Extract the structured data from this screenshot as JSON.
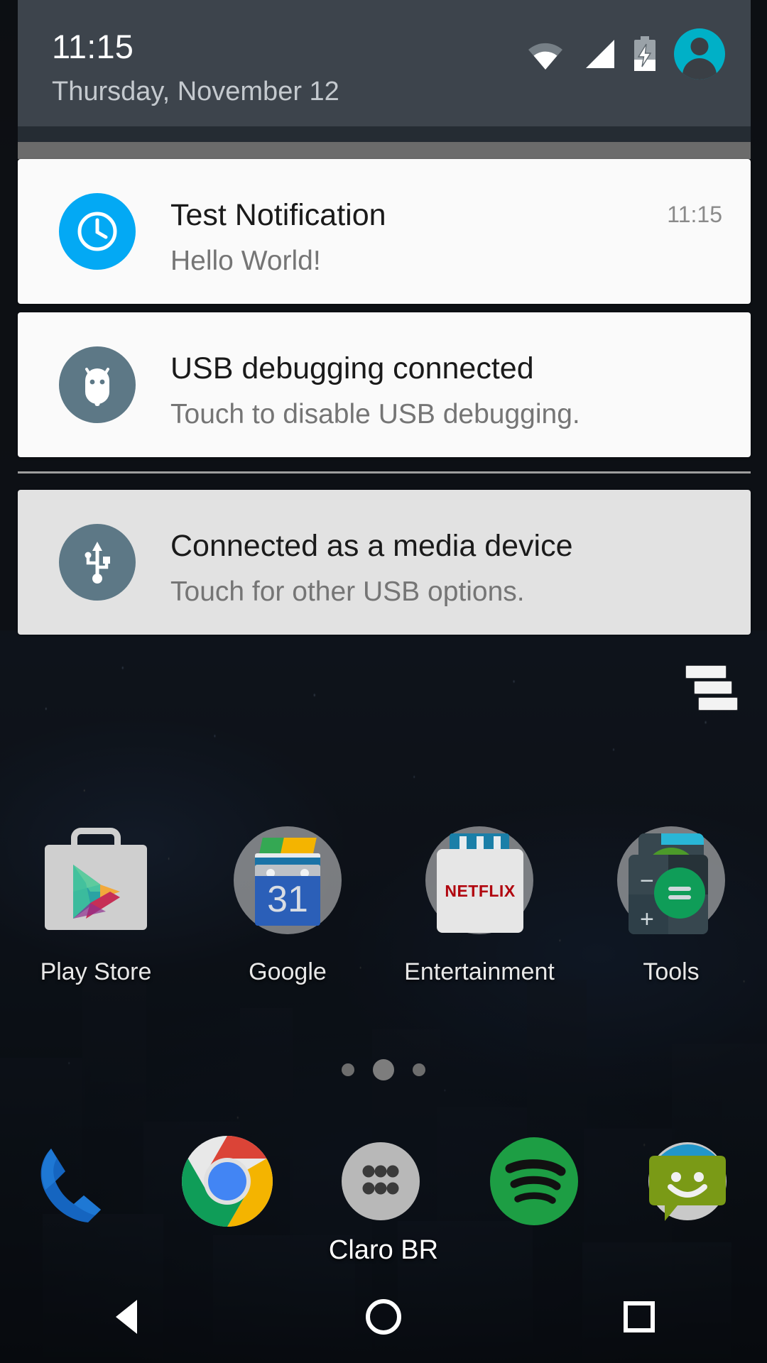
{
  "status_bar": {
    "time": "11:15",
    "date": "Thursday, November 12",
    "icons": [
      "wifi-icon",
      "cellular-signal-icon",
      "battery-charging-icon"
    ],
    "avatar_name": "user-avatar",
    "header_bg": "#3d444c",
    "avatar_color": "#00b0c7"
  },
  "notifications": [
    {
      "id": "test-notification",
      "title": "Test Notification",
      "text": "Hello World!",
      "time": "11:15",
      "icon": "clock-icon",
      "icon_bg": "#03a9f4",
      "dimmed": false
    },
    {
      "id": "usb-debugging",
      "title": "USB debugging connected",
      "text": "Touch to disable USB debugging.",
      "time": "",
      "icon": "android-bug-icon",
      "icon_bg": "#5d7886",
      "dimmed": false
    },
    {
      "id": "media-device",
      "title": "Connected as a media device",
      "text": "Touch for other USB options.",
      "time": "",
      "icon": "usb-icon",
      "icon_bg": "#5d7886",
      "dimmed": true
    }
  ],
  "clear_all": {
    "name": "clear-all-notifications-button"
  },
  "homescreen": {
    "apps": [
      {
        "label": "Play Store",
        "icon": "play-store-icon",
        "folder": false
      },
      {
        "label": "Google",
        "icon": "google-folder-icon",
        "folder": true,
        "badge": "31"
      },
      {
        "label": "Entertainment",
        "icon": "entertainment-folder-icon",
        "folder": true,
        "brand": "NETFLIX"
      },
      {
        "label": "Tools",
        "icon": "tools-folder-icon",
        "folder": true
      }
    ],
    "page_indicator": {
      "pages": 3,
      "current": 2
    },
    "dock": [
      {
        "label": "Phone",
        "icon": "phone-icon"
      },
      {
        "label": "Chrome",
        "icon": "chrome-icon"
      },
      {
        "label": "Apps",
        "icon": "app-drawer-icon"
      },
      {
        "label": "Spotify",
        "icon": "spotify-icon"
      },
      {
        "label": "Messaging",
        "icon": "messaging-icon"
      }
    ],
    "carrier": "Claro BR"
  },
  "navbar": {
    "back": "back-button",
    "home": "home-button",
    "recents": "recents-button"
  }
}
